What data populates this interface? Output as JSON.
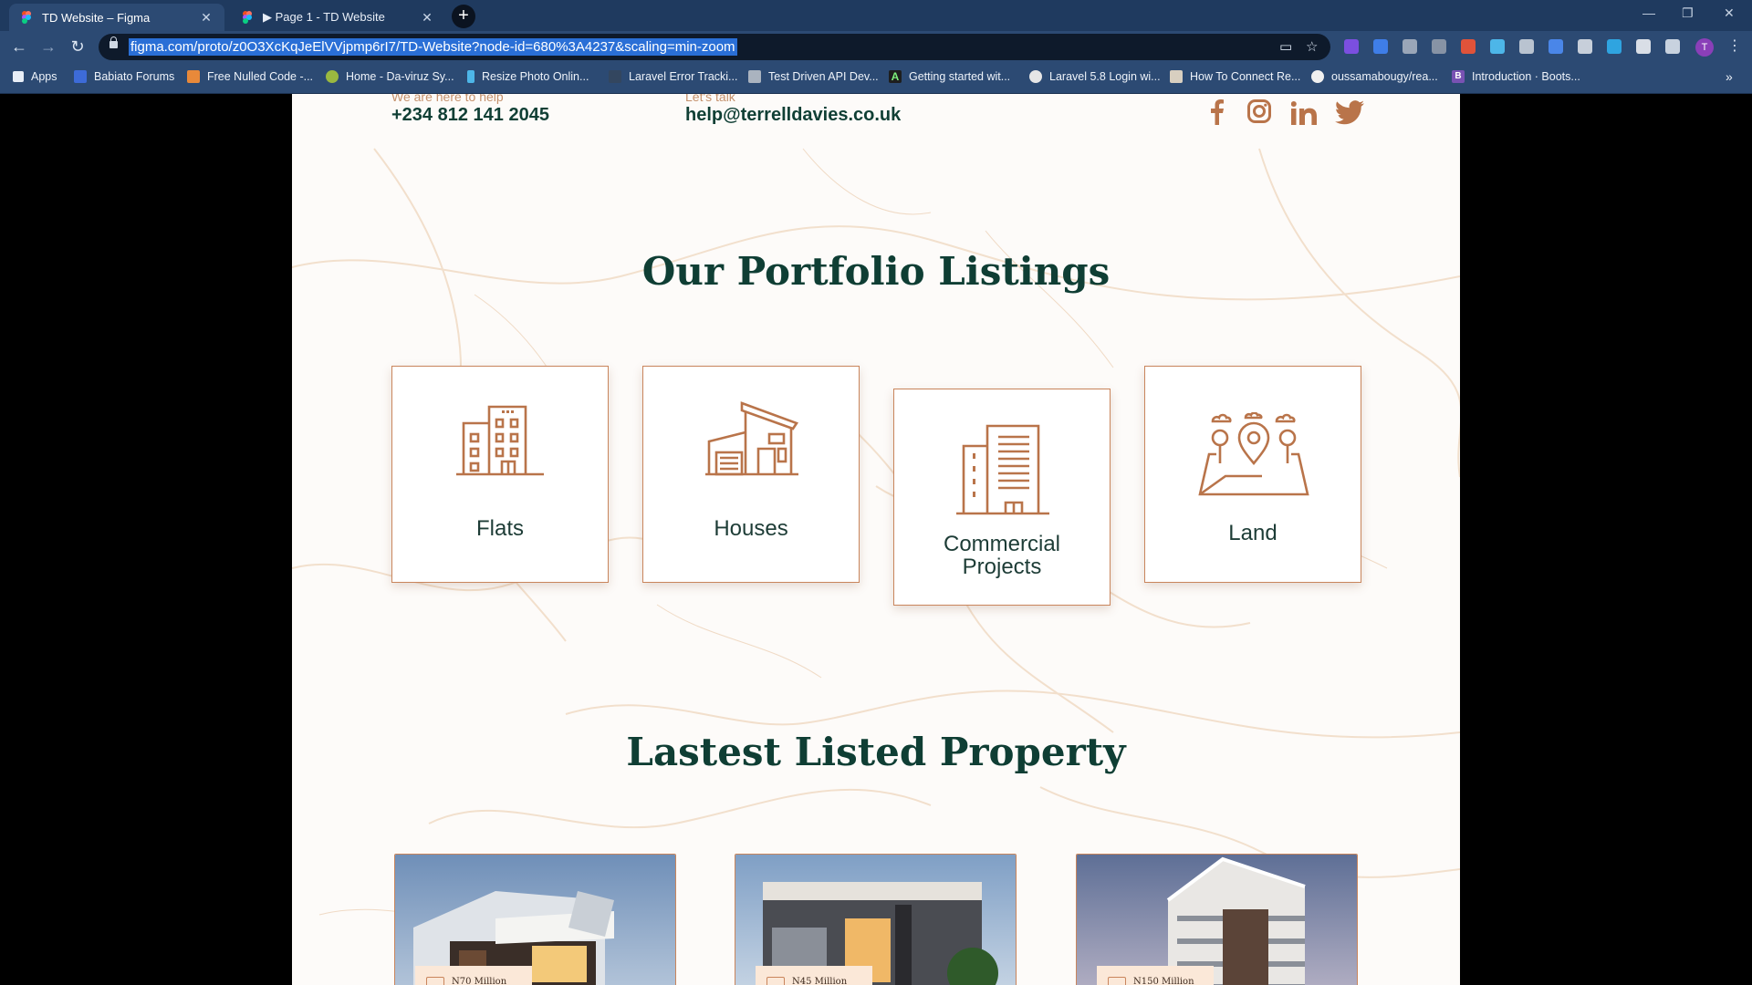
{
  "browser": {
    "tabs": [
      {
        "title": "TD Website – Figma",
        "active": true
      },
      {
        "title": "▶ Page 1 - TD Website",
        "active": false
      }
    ],
    "url": "figma.com/proto/z0O3XcKqJeElVVjpmp6rI7/TD-Website?node-id=680%3A4237&scaling=min-zoom",
    "bookmarks": [
      "Apps",
      "Babiato Forums",
      "Free Nulled Code -...",
      "Home - Da-viruz Sy...",
      "Resize Photo Onlin...",
      "Laravel Error Tracki...",
      "Test Driven API Dev...",
      "Getting started wit...",
      "Laravel 5.8 Login wi...",
      "How To Connect Re...",
      "oussamabougy/rea...",
      "Introduction · Boots..."
    ],
    "avatar_letter": "T"
  },
  "contact": {
    "phone_caption": "We are here to help",
    "phone": "+234 812 141 2045",
    "email_caption": "Let's talk",
    "email": "help@terrelldavies.co.uk",
    "social": [
      "facebook-icon",
      "instagram-icon",
      "linkedin-icon",
      "twitter-icon"
    ]
  },
  "portfolio": {
    "heading": "Our Portfolio Listings",
    "categories": [
      {
        "label": "Flats",
        "icon": "apartment-building-icon"
      },
      {
        "label": "Houses",
        "icon": "house-icon"
      },
      {
        "label": "Commercial Projects",
        "line1": "Commercial",
        "line2": "Projects",
        "icon": "office-building-icon"
      },
      {
        "label": "Land",
        "icon": "land-map-pin-icon"
      }
    ]
  },
  "latest": {
    "heading": "Lastest Listed Property",
    "properties": [
      {
        "price": "N70 Million"
      },
      {
        "price": "N45 Million"
      },
      {
        "price": "N150 Million"
      }
    ]
  },
  "colors": {
    "brand_green": "#0f3e34",
    "accent_copper": "#b9744a",
    "chrome_blue": "#2c4a73"
  }
}
